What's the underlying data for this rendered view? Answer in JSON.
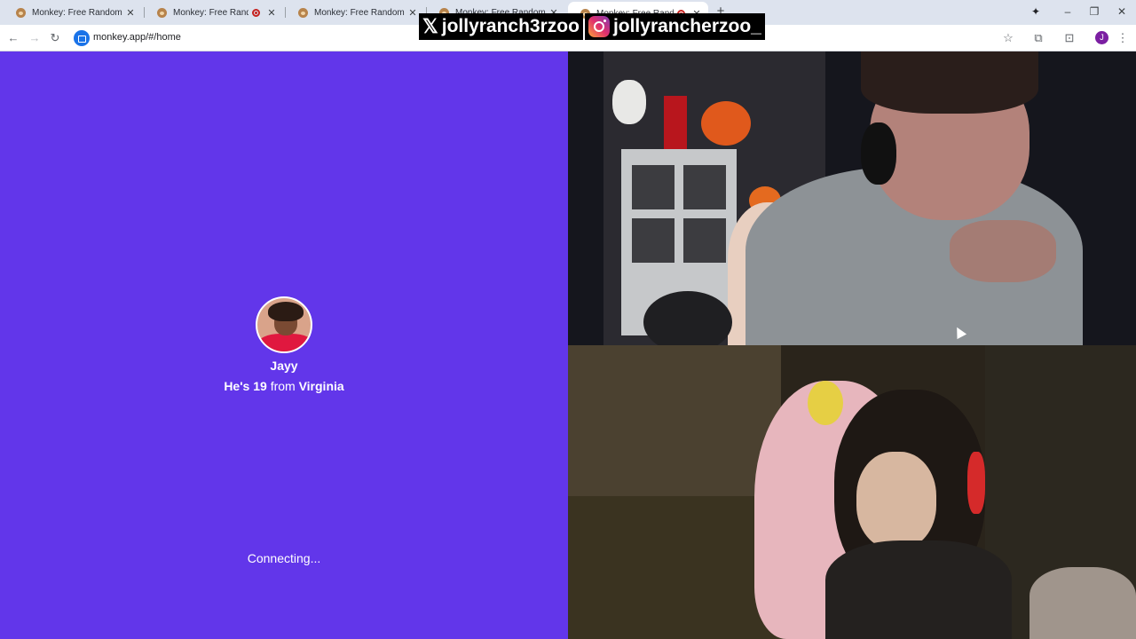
{
  "browser": {
    "tabs": [
      {
        "title": "Monkey: Free Random Video Chat",
        "recording": false,
        "active": false
      },
      {
        "title": "Monkey: Free Random Video Chat",
        "recording": true,
        "active": false
      },
      {
        "title": "Monkey: Free Random Video Chat",
        "recording": false,
        "active": false
      },
      {
        "title": "Monkey: Free Random Video Chat",
        "recording": false,
        "active": false
      },
      {
        "title": "Monkey: Free Random Video Chat",
        "recording": true,
        "active": true
      }
    ],
    "url": "monkey.app/#/home",
    "profile_initial": "J"
  },
  "overlay": {
    "x_handle": "jollyranch3rzoo",
    "instagram_handle": "jollyrancherzoo_"
  },
  "match": {
    "name": "Jayy",
    "pronoun_prefix": "He's",
    "age": "19",
    "from_word": "from",
    "location": "Virginia",
    "status": "Connecting..."
  },
  "colors": {
    "panel_purple": "#6236ea"
  },
  "icons": [
    "back-icon",
    "forward-icon",
    "reload-icon",
    "site-icon",
    "star-icon",
    "extensions-icon",
    "tab-search-icon",
    "menu-icon",
    "x-logo-icon",
    "instagram-icon",
    "cursor-icon"
  ]
}
